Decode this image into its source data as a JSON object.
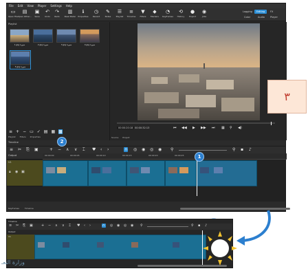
{
  "menu": [
    "File",
    "Edit",
    "View",
    "Player",
    "Settings",
    "Help"
  ],
  "toolbar": [
    {
      "label": "Open File",
      "icon": "folder-icon"
    },
    {
      "label": "Open Other...",
      "icon": "open-other-icon"
    },
    {
      "label": "Save",
      "icon": "save-icon"
    },
    {
      "label": "Undo",
      "icon": "undo-icon"
    },
    {
      "label": "Redo",
      "icon": "redo-icon"
    },
    {
      "label": "Peak Meter",
      "icon": "meter-icon"
    },
    {
      "label": "Properties",
      "icon": "info-icon"
    },
    {
      "label": "Recent",
      "icon": "recent-icon"
    },
    {
      "label": "Notes",
      "icon": "notes-icon"
    },
    {
      "label": "Playlist",
      "icon": "playlist-icon"
    },
    {
      "label": "Timeline",
      "icon": "timeline-icon"
    },
    {
      "label": "Filters",
      "icon": "filter-icon"
    },
    {
      "label": "Markers",
      "icon": "markers-icon"
    },
    {
      "label": "Keyframes",
      "icon": "keyframes-icon"
    },
    {
      "label": "History",
      "icon": "history-icon"
    },
    {
      "label": "Export",
      "icon": "export-icon"
    },
    {
      "label": "Jobs",
      "icon": "jobs-icon"
    }
  ],
  "layouts": {
    "row1": [
      "Logging",
      "Editing",
      "FX"
    ],
    "row2": [
      "Color",
      "Audio",
      "Player"
    ],
    "active": "Editing"
  },
  "playlist": {
    "title": "Playlist",
    "items": [
      "1.jpg صورة",
      "2.jpg صورة",
      "3.jpg صورة",
      "4.jpg صورة",
      "5.jpg صورة"
    ],
    "tabs": [
      "Playlist",
      "Filters",
      "Properties"
    ]
  },
  "viewer": {
    "timecode_current": "00:00:20:18",
    "timecode_total": "00:00:32:13",
    "tabs": [
      "Source",
      "Project"
    ]
  },
  "timeline": {
    "label": "Timeline",
    "track_output": "Output",
    "track_v1": "V1",
    "ruler": [
      "00:00:00",
      "00:00:05",
      "00:00:10",
      "00:00:15",
      "00:00:20",
      "00:00:25"
    ],
    "bottom_tabs": [
      "Keyframes",
      "Timeline"
    ]
  },
  "badges": [
    "1",
    "2",
    "3"
  ],
  "callout": "٣",
  "timeline2": {
    "label": "Timeline",
    "track_output": "Output",
    "track_v1": "V1"
  },
  "logo_text": "وزارة التعـ"
}
